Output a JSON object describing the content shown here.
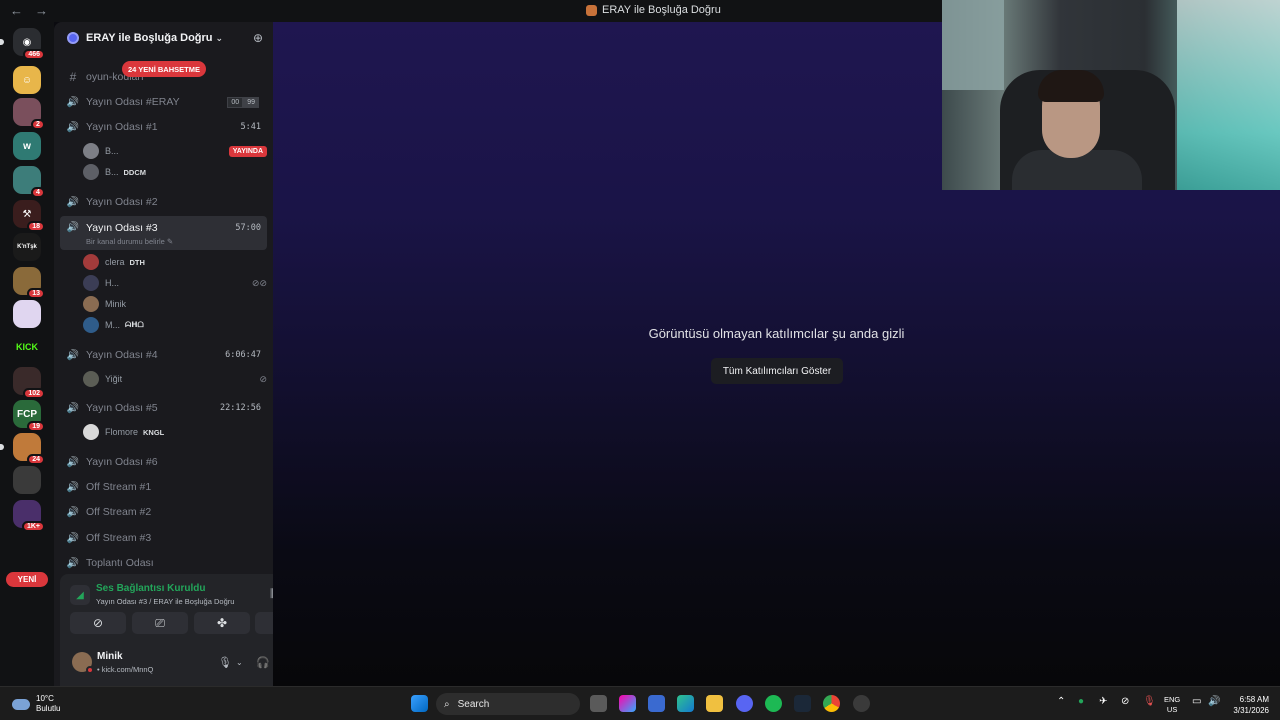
{
  "window": {
    "title": "ERAY ile Boşluğa Doğru",
    "back": "←",
    "forward": "→"
  },
  "rail": {
    "servers": [
      {
        "id": "discord-home",
        "badge": "466",
        "color": "#2b2d31",
        "glyph": "◉"
      },
      {
        "id": "server-2",
        "badge": "",
        "color": "#e8b64a",
        "glyph": "☺"
      },
      {
        "id": "server-3",
        "badge": "2",
        "color": "#7a4f5c",
        "glyph": ""
      },
      {
        "id": "server-wiki",
        "badge": "",
        "color": "#2f7a73",
        "glyph": "w"
      },
      {
        "id": "server-5",
        "badge": "4",
        "color": "#3d7d7a",
        "glyph": ""
      },
      {
        "id": "server-6",
        "badge": "18",
        "color": "#3a1d1d",
        "glyph": "⚒"
      },
      {
        "id": "server-knt",
        "badge": "",
        "color": "#1a1a1a",
        "glyph": "K'nTşk"
      },
      {
        "id": "server-8",
        "badge": "13",
        "color": "#8a6a3a",
        "glyph": ""
      },
      {
        "id": "server-9",
        "badge": "",
        "color": "#e0d6f0",
        "glyph": ""
      },
      {
        "id": "server-kick",
        "badge": "",
        "color": "#111214",
        "glyph": "KICK"
      },
      {
        "id": "server-11",
        "badge": "102",
        "color": "#3a2a2a",
        "glyph": ""
      },
      {
        "id": "server-fcp",
        "badge": "19",
        "color": "#2a6a3a",
        "glyph": "FCP"
      },
      {
        "id": "server-13",
        "badge": "24",
        "color": "#c07a3a",
        "glyph": ""
      },
      {
        "id": "server-14",
        "badge": "",
        "color": "#3a3a3a",
        "glyph": ""
      },
      {
        "id": "server-15",
        "badge": "1K+",
        "color": "#4a2f6a",
        "glyph": ""
      }
    ],
    "new_label": "YENİ"
  },
  "guild": {
    "name": "ERAY ile Boşluğa Doğru",
    "mention_pill": "24 YENİ BAHSETME"
  },
  "channels": [
    {
      "type": "text",
      "name": "oyun-kodları",
      "state": "dim"
    },
    {
      "type": "voice",
      "name": "Yayın Odası #ERAY",
      "counts": [
        "00",
        "99"
      ],
      "live": true
    },
    {
      "type": "voice",
      "name": "Yayın Odası #1",
      "time": "5:41",
      "live": true
    },
    {
      "type": "voice",
      "name": "Yayın Odası #2",
      "live": false
    },
    {
      "type": "voice",
      "name": "Yayın Odası #3",
      "time": "57:00",
      "status": "Bir kanal durumu belirle ✎",
      "live": true,
      "active": true
    },
    {
      "type": "voice",
      "name": "Yayın Odası #4",
      "time": "6:06:47",
      "live": true
    },
    {
      "type": "voice",
      "name": "Yayın Odası #5",
      "time": "22:12:56",
      "live": true
    },
    {
      "type": "voice",
      "name": "Yayın Odası #6",
      "live": false
    },
    {
      "type": "voice",
      "name": "Off Stream #1",
      "live": false
    },
    {
      "type": "voice",
      "name": "Off Stream #2",
      "live": false
    },
    {
      "type": "voice",
      "name": "Off Stream #3",
      "live": false
    },
    {
      "type": "voice",
      "name": "Toplantı Odası",
      "live": false
    }
  ],
  "users": {
    "room1": [
      {
        "name": "B...",
        "tag": "",
        "live": "YAYINDA"
      },
      {
        "name": "B...",
        "tag": "DDCM"
      }
    ],
    "room3": [
      {
        "name": "clera",
        "tag": "DTH"
      },
      {
        "name": "H..."
      },
      {
        "name": "Minik"
      },
      {
        "name": "M...",
        "tag": "ᗣᕼᗝ"
      }
    ],
    "room4": [
      {
        "name": "Yiğit"
      }
    ],
    "room5": [
      {
        "name": "Flomore",
        "tag": "KNGL"
      }
    ]
  },
  "voice_panel": {
    "title": "Ses Bağlantısı Kuruldu",
    "subtitle": "Yayın Odası #3 / ERAY ile Boşluğa Doğru",
    "user_name": "Minik",
    "user_status": "• kick.com/MnnQ"
  },
  "stage": {
    "message": "Görüntüsü olmayan katılımcılar şu anda gizli",
    "button": "Tüm Katılımcıları Göster"
  },
  "taskbar": {
    "temp": "10°C",
    "weather": "Bulutlu",
    "search": "Search",
    "lang1": "ENG",
    "lang2": "US",
    "time": "6:58 AM",
    "date": "3/31/2026"
  }
}
